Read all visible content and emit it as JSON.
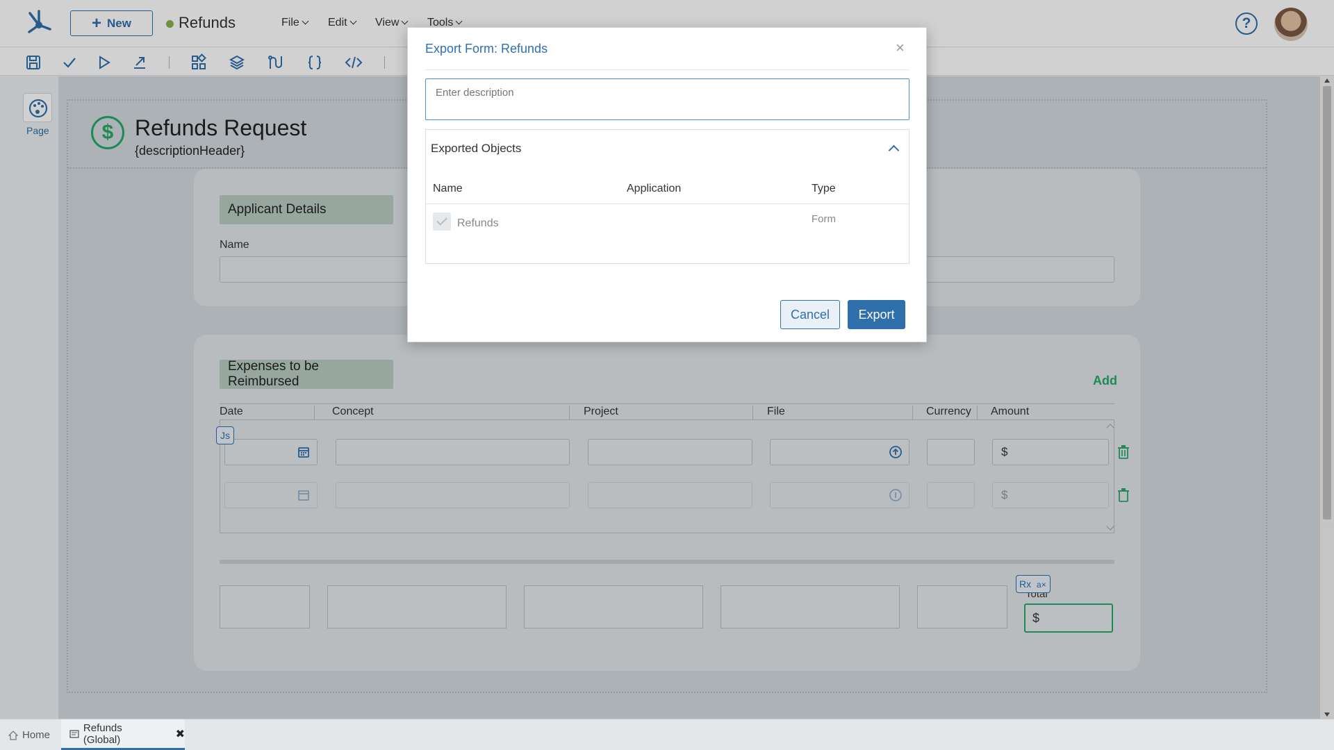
{
  "topbar": {
    "new_label": "New",
    "doc_title": "Refunds",
    "menus": [
      "File",
      "Edit",
      "View",
      "Tools"
    ]
  },
  "left_panel": {
    "page_label": "Page"
  },
  "form": {
    "title": "Refunds Request",
    "subtitle": "{descriptionHeader}",
    "applicant_section": "Applicant Details",
    "name_label": "Name",
    "expenses_section": "Expenses to be Reimbursed",
    "add_label": "Add",
    "grid_columns": [
      "Date",
      "Concept",
      "Project",
      "File",
      "Currency",
      "Amount"
    ],
    "currency_symbol": "$",
    "js_badge": "Js",
    "rx_badge": "Rx",
    "total_label": "Total",
    "total_value": "$"
  },
  "modal": {
    "title": "Export Form: Refunds",
    "close_symbol": "×",
    "description_placeholder": "Enter description",
    "panel_title": "Exported Objects",
    "columns": {
      "name": "Name",
      "application": "Application",
      "type": "Type"
    },
    "row": {
      "name": "Refunds",
      "application": "",
      "type": "Form"
    },
    "cancel_label": "Cancel",
    "export_label": "Export"
  },
  "bottom_tabs": {
    "home_label": "Home",
    "active_tab_label": "Refunds (Global)",
    "close_symbol": "✖"
  },
  "colors": {
    "accent": "#2f6fab",
    "success": "#26a86b",
    "status_dot": "#8ab34a"
  }
}
